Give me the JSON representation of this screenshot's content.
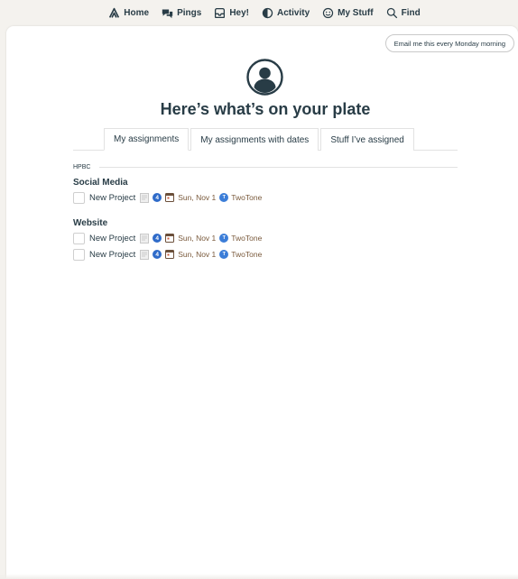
{
  "nav": {
    "items": [
      {
        "label": "Home",
        "icon": "home-icon"
      },
      {
        "label": "Pings",
        "icon": "pings-icon"
      },
      {
        "label": "Hey!",
        "icon": "hey-icon"
      },
      {
        "label": "Activity",
        "icon": "activity-icon"
      },
      {
        "label": "My Stuff",
        "icon": "my-stuff-icon"
      },
      {
        "label": "Find",
        "icon": "search-icon"
      }
    ]
  },
  "email_button": "Email me this every Monday morning",
  "page_title": "Here’s what’s on your plate",
  "tabs": [
    {
      "label": "My assignments",
      "active": true
    },
    {
      "label": "My assignments with dates",
      "active": false
    },
    {
      "label": "Stuff I’ve assigned",
      "active": false
    }
  ],
  "group": {
    "name": "HPBC",
    "sections": [
      {
        "title": "Social Media",
        "todos": [
          {
            "title": "New Project",
            "comments": "4",
            "due": "Sun, Nov 1",
            "assignee_initial": "T",
            "assignee": "TwoTone"
          }
        ]
      },
      {
        "title": "Website",
        "todos": [
          {
            "title": "New Project",
            "comments": "4",
            "due": "Sun, Nov 1",
            "assignee_initial": "T",
            "assignee": "TwoTone"
          },
          {
            "title": "New Project",
            "comments": "4",
            "due": "Sun, Nov 1",
            "assignee_initial": "T",
            "assignee": "TwoTone"
          }
        ]
      }
    ]
  },
  "colors": {
    "text": "#283c46",
    "accent_blue": "#2f6bc9",
    "due_brown": "#7a5a3c",
    "background": "#f4f2ee"
  }
}
